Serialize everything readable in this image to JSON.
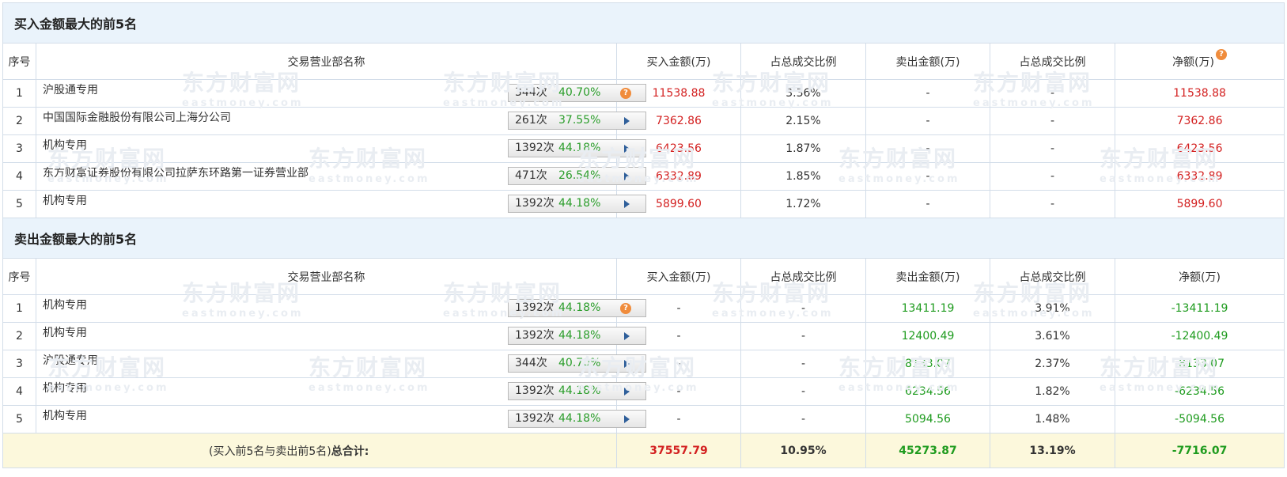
{
  "watermark": {
    "cn": "东方财富网",
    "en": "eastmoney.com"
  },
  "buy_section": {
    "title": "买入金额最大的前5名",
    "headers": [
      "序号",
      "交易营业部名称",
      "买入金额(万)",
      "占总成交比例",
      "卖出金额(万)",
      "占总成交比例",
      "净额(万)"
    ],
    "rows": [
      {
        "idx": "1",
        "name": "沪股通专用",
        "count": "344次",
        "pct": "40.70%",
        "icon": "question-icon",
        "buy": "11538.88",
        "buy_ratio": "3.36%",
        "sell": "-",
        "sell_ratio": "-",
        "net": "11538.88"
      },
      {
        "idx": "2",
        "name": "中国国际金融股份有限公司上海分公司",
        "count": "261次",
        "pct": "37.55%",
        "icon": "arrow-right-icon",
        "buy": "7362.86",
        "buy_ratio": "2.15%",
        "sell": "-",
        "sell_ratio": "-",
        "net": "7362.86"
      },
      {
        "idx": "3",
        "name": "机构专用",
        "count": "1392次",
        "pct": "44.18%",
        "icon": "arrow-right-icon",
        "buy": "6423.56",
        "buy_ratio": "1.87%",
        "sell": "-",
        "sell_ratio": "-",
        "net": "6423.56"
      },
      {
        "idx": "4",
        "name": "东方财富证券股份有限公司拉萨东环路第一证券营业部",
        "count": "471次",
        "pct": "26.54%",
        "icon": "arrow-right-icon",
        "buy": "6332.89",
        "buy_ratio": "1.85%",
        "sell": "-",
        "sell_ratio": "-",
        "net": "6332.89"
      },
      {
        "idx": "5",
        "name": "机构专用",
        "count": "1392次",
        "pct": "44.18%",
        "icon": "arrow-right-icon",
        "buy": "5899.60",
        "buy_ratio": "1.72%",
        "sell": "-",
        "sell_ratio": "-",
        "net": "5899.60"
      }
    ]
  },
  "sell_section": {
    "title": "卖出金额最大的前5名",
    "headers": [
      "序号",
      "交易营业部名称",
      "买入金额(万)",
      "占总成交比例",
      "卖出金额(万)",
      "占总成交比例",
      "净额(万)"
    ],
    "rows": [
      {
        "idx": "1",
        "name": "机构专用",
        "count": "1392次",
        "pct": "44.18%",
        "icon": "question-icon",
        "buy": "-",
        "buy_ratio": "-",
        "sell": "13411.19",
        "sell_ratio": "3.91%",
        "net": "-13411.19"
      },
      {
        "idx": "2",
        "name": "机构专用",
        "count": "1392次",
        "pct": "44.18%",
        "icon": "arrow-right-icon",
        "buy": "-",
        "buy_ratio": "-",
        "sell": "12400.49",
        "sell_ratio": "3.61%",
        "net": "-12400.49"
      },
      {
        "idx": "3",
        "name": "沪股通专用",
        "count": "344次",
        "pct": "40.70%",
        "icon": "arrow-right-icon",
        "buy": "-",
        "buy_ratio": "-",
        "sell": "8133.07",
        "sell_ratio": "2.37%",
        "net": "-8133.07"
      },
      {
        "idx": "4",
        "name": "机构专用",
        "count": "1392次",
        "pct": "44.18%",
        "icon": "arrow-right-icon",
        "buy": "-",
        "buy_ratio": "-",
        "sell": "6234.56",
        "sell_ratio": "1.82%",
        "net": "-6234.56"
      },
      {
        "idx": "5",
        "name": "机构专用",
        "count": "1392次",
        "pct": "44.18%",
        "icon": "arrow-right-icon",
        "buy": "-",
        "buy_ratio": "-",
        "sell": "5094.56",
        "sell_ratio": "1.48%",
        "net": "-5094.56"
      }
    ]
  },
  "total": {
    "label_prefix": "(买入前5名与卖出前5名)",
    "label_bold": "总合计:",
    "buy": "37557.79",
    "buy_ratio": "10.95%",
    "sell": "45273.87",
    "sell_ratio": "13.19%",
    "net": "-7716.07"
  },
  "colors": {
    "buy_red": "#d32020",
    "sell_green": "#1e9b1e",
    "title_bg": "#eaf3fb",
    "total_bg": "#fcf8dc",
    "badge_orange": "#f08c3c"
  }
}
